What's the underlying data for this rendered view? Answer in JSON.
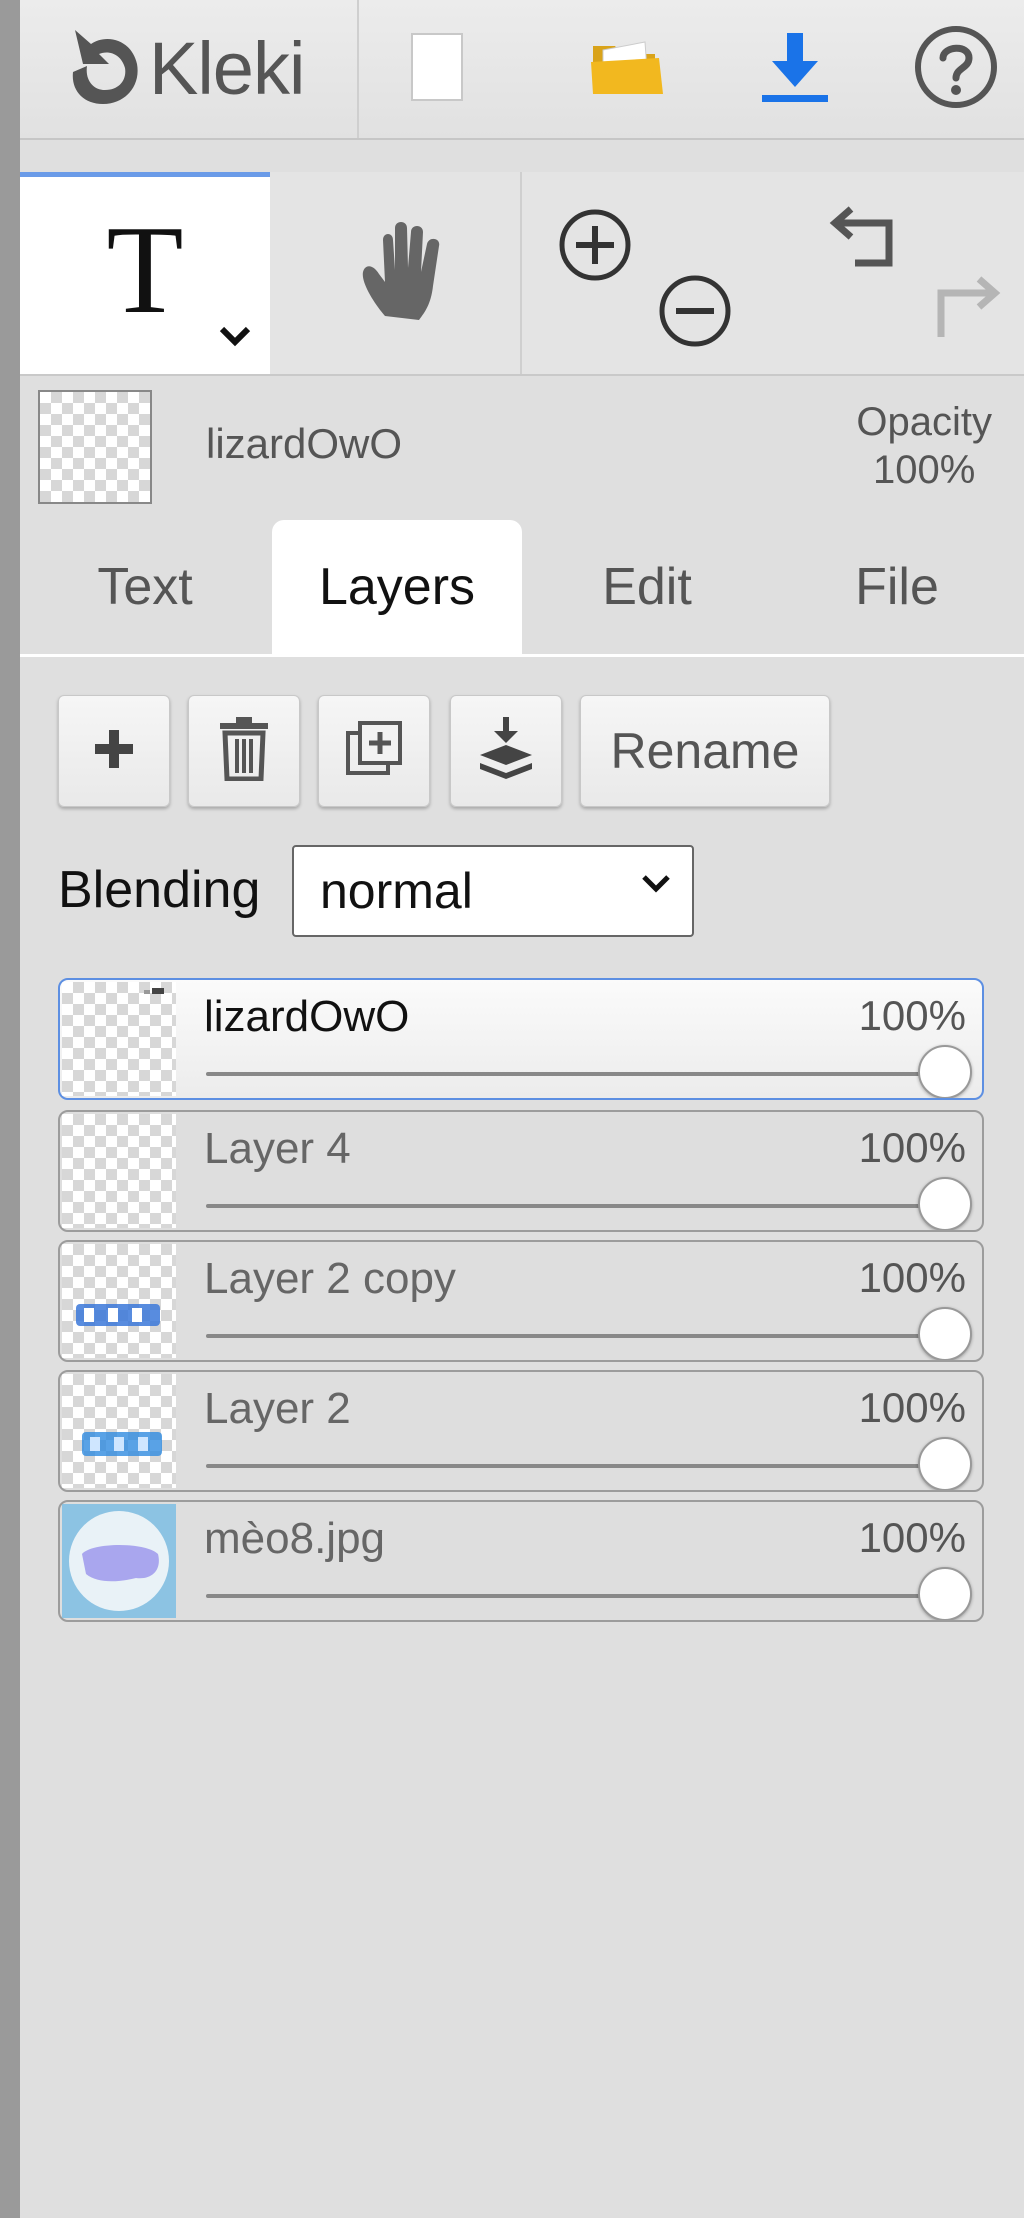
{
  "app": {
    "name": "Kleki"
  },
  "top_buttons": [
    {
      "name": "new-image",
      "icon": "blank-page-icon"
    },
    {
      "name": "open-file",
      "icon": "folder-icon"
    },
    {
      "name": "save-download",
      "icon": "download-icon"
    },
    {
      "name": "help",
      "icon": "help-circle-icon"
    }
  ],
  "tools": {
    "text_tool_glyph": "T",
    "hand_icon": "hand-icon",
    "zoom_in_icon": "zoom-in-icon",
    "zoom_out_icon": "zoom-out-icon",
    "undo_icon": "undo-icon",
    "redo_icon": "redo-icon"
  },
  "current_layer": {
    "name": "lizardOwO",
    "opacity_label": "Opacity",
    "opacity_value": "100%"
  },
  "tabs": [
    {
      "label": "Text",
      "active": false
    },
    {
      "label": "Layers",
      "active": true
    },
    {
      "label": "Edit",
      "active": false
    },
    {
      "label": "File",
      "active": false
    }
  ],
  "layer_buttons": {
    "add_icon": "plus-icon",
    "delete_icon": "trash-icon",
    "duplicate_icon": "duplicate-icon",
    "merge_icon": "merge-down-icon",
    "rename_label": "Rename"
  },
  "blending": {
    "label": "Blending",
    "value": "normal"
  },
  "layers": [
    {
      "name": "lizardOwO",
      "opacity": "100%",
      "opacity_fraction": 1.0,
      "selected": true
    },
    {
      "name": "Layer 4",
      "opacity": "100%",
      "opacity_fraction": 1.0,
      "selected": false
    },
    {
      "name": "Layer 2 copy",
      "opacity": "100%",
      "opacity_fraction": 1.0,
      "selected": false
    },
    {
      "name": "Layer 2",
      "opacity": "100%",
      "opacity_fraction": 1.0,
      "selected": false
    },
    {
      "name": "mèo8.jpg",
      "opacity": "100%",
      "opacity_fraction": 1.0,
      "selected": false
    }
  ],
  "colors": {
    "accent": "#5d8fe2",
    "download_blue": "#1a73e8",
    "folder_yellow": "#f2b81f"
  }
}
